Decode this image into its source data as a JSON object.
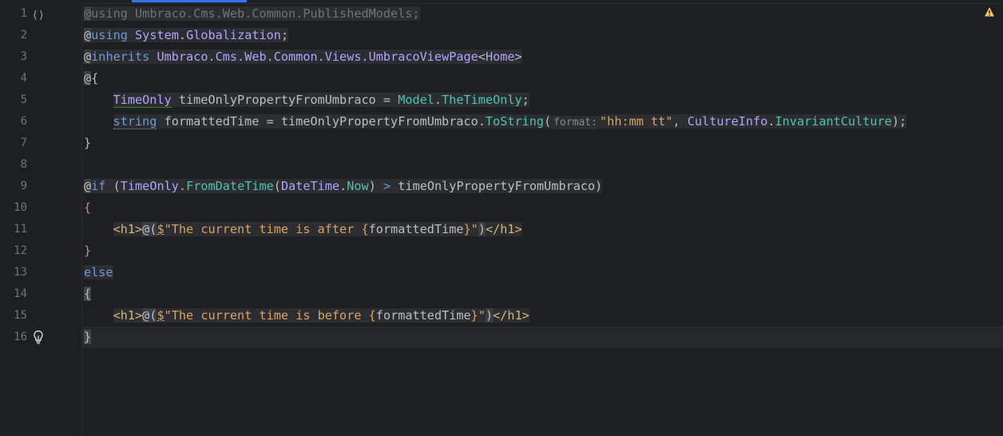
{
  "line_numbers": [
    "1",
    "2",
    "3",
    "4",
    "5",
    "6",
    "7",
    "8",
    "9",
    "10",
    "11",
    "12",
    "13",
    "14",
    "15",
    "16"
  ],
  "code": {
    "l1": {
      "at": "@",
      "kw": "using",
      "ns": "Umbraco.Cms.Web.Common.PublishedModels",
      "semi": ";"
    },
    "l2": {
      "at": "@",
      "kw": "using",
      "ns1": "System",
      "dot": ".",
      "ns2": "Globalization",
      "semi": ";"
    },
    "l3": {
      "at": "@",
      "kw": "inherits",
      "ns": "Umbraco.Cms.Web.Common.Views.UmbracoViewPage",
      "lt": "<",
      "model": "Home",
      "gt": ">"
    },
    "l4": {
      "at": "@",
      "brace": "{"
    },
    "l5": {
      "type": "TimeOnly",
      "var": " timeOnlyPropertyFromUmbraco = ",
      "obj": "Model",
      "dot": ".",
      "prop": "TheTimeOnly",
      "semi": ";"
    },
    "l6": {
      "type": "string",
      "var": " formattedTime = timeOnlyPropertyFromUmbraco.",
      "method": "ToString",
      "open": "(",
      "hint": "format:",
      "str": "\"hh:mm tt\"",
      "comma": ", ",
      "cls": "CultureInfo",
      "dot": ".",
      "prop": "InvariantCulture",
      "close": ");"
    },
    "l7": {
      "brace": "}"
    },
    "l9": {
      "at": "@",
      "kw": "if",
      "open": " (",
      "cls1": "TimeOnly",
      "dot1": ".",
      "m1": "FromDateTime",
      "open2": "(",
      "cls2": "DateTime",
      "dot2": ".",
      "m2": "Now",
      "close": ") ",
      "gt": ">",
      "rest": " timeOnlyPropertyFromUmbraco)"
    },
    "l10": {
      "brace": "{"
    },
    "l11": {
      "tag_open": "<h1>",
      "at": "@(",
      "dollar": "$",
      "str1": "\"The current time is after ",
      "ib": "{",
      "interp": "formattedTime",
      "ie": "}",
      "str2": "\"",
      "paren": ")",
      "tag_close": "</h1>"
    },
    "l12": {
      "brace": "}"
    },
    "l13": {
      "kw": "else"
    },
    "l14": {
      "brace": "{"
    },
    "l15": {
      "tag_open": "<h1>",
      "at": "@(",
      "dollar": "$",
      "str1": "\"The current time is before ",
      "ib": "{",
      "interp": "formattedTime",
      "ie": "}",
      "str2": "\"",
      "paren": ")",
      "tag_close": "</h1>"
    },
    "l16": {
      "brace": "}"
    }
  },
  "icons": {
    "fold": "fold-icon",
    "bulb": "lightbulb-icon",
    "warning": "warning-icon"
  },
  "fold_glyph": "⟨⟩",
  "colors": {
    "background": "#1e1f22",
    "accent": "#3574f0",
    "warning": "#f2c55c"
  }
}
